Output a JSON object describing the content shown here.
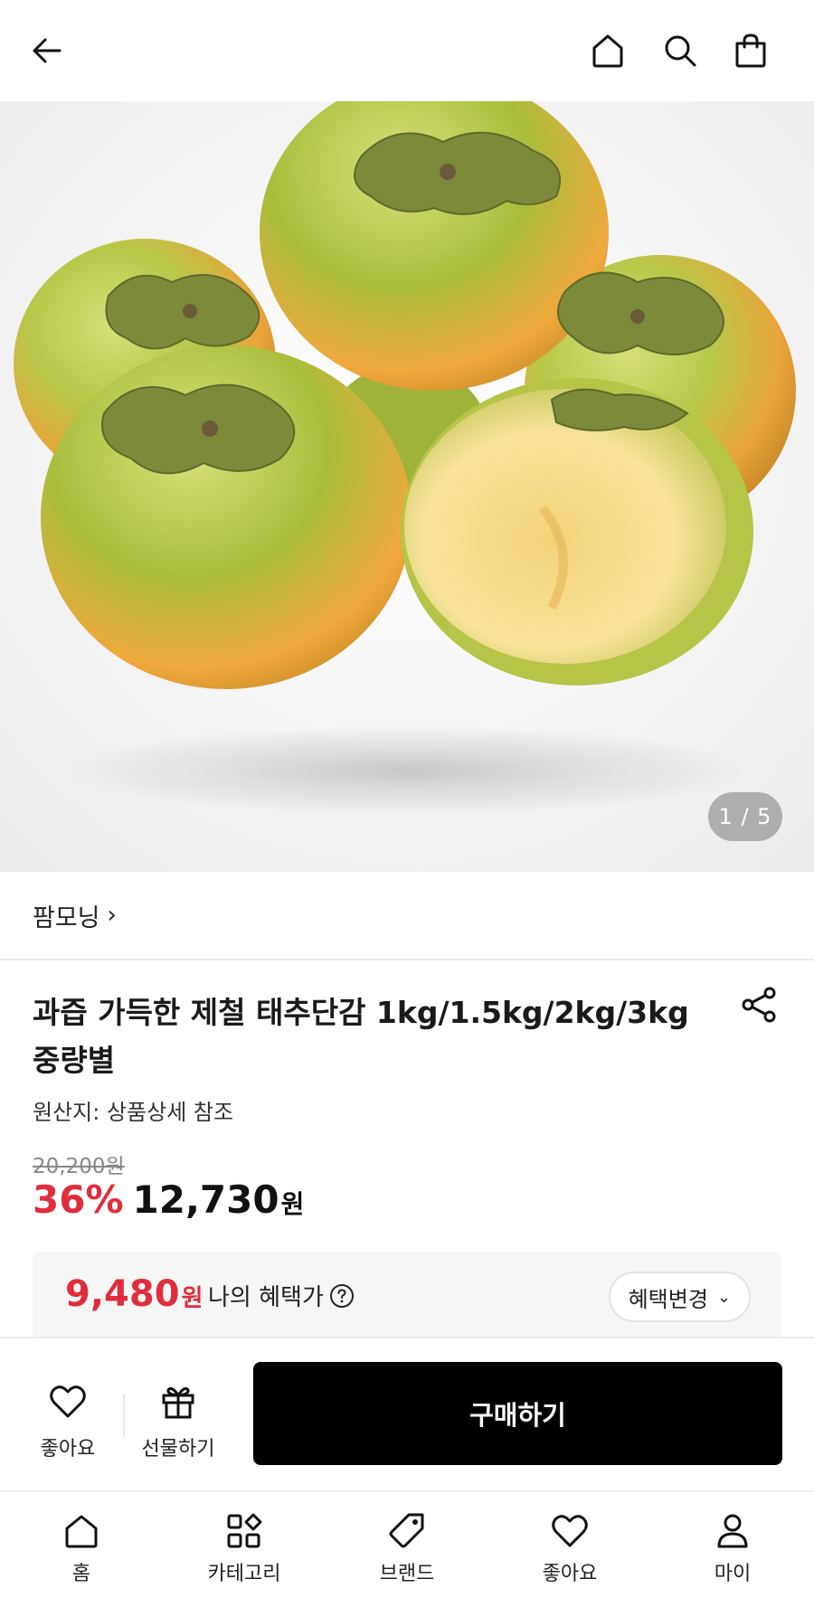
{
  "header": {
    "back_icon": "arrow-left-icon",
    "home_icon": "home-icon",
    "search_icon": "search-icon",
    "cart_icon": "shopping-bag-icon"
  },
  "gallery": {
    "counter": "1 / 5",
    "image_subject": "persimmons"
  },
  "brand": {
    "name": "팜모닝",
    "chevron": "›"
  },
  "product": {
    "title": "과즙 가득한 제철 태추단감 1kg/1.5kg/2kg/3kg 중량별",
    "origin_label": "원산지:",
    "origin_value": " 상품상세 참조",
    "original_price": "20,200원",
    "discount": "36%",
    "price": "12,730",
    "price_unit": "원"
  },
  "benefit": {
    "price": "9,480",
    "unit": "원",
    "label": "나의 혜택가",
    "change_label": "혜택변경",
    "change_chevron": "⌄"
  },
  "actions": {
    "like_label": "좋아요",
    "gift_label": "선물하기",
    "buy_label": "구매하기"
  },
  "nav": {
    "items": [
      {
        "label": "홈",
        "icon": "home-icon"
      },
      {
        "label": "카테고리",
        "icon": "category-icon"
      },
      {
        "label": "브랜드",
        "icon": "tag-icon"
      },
      {
        "label": "좋아요",
        "icon": "heart-icon"
      },
      {
        "label": "마이",
        "icon": "user-icon"
      }
    ]
  },
  "colors": {
    "accent_red": "#e02d3c",
    "buy_button": "#000000"
  }
}
